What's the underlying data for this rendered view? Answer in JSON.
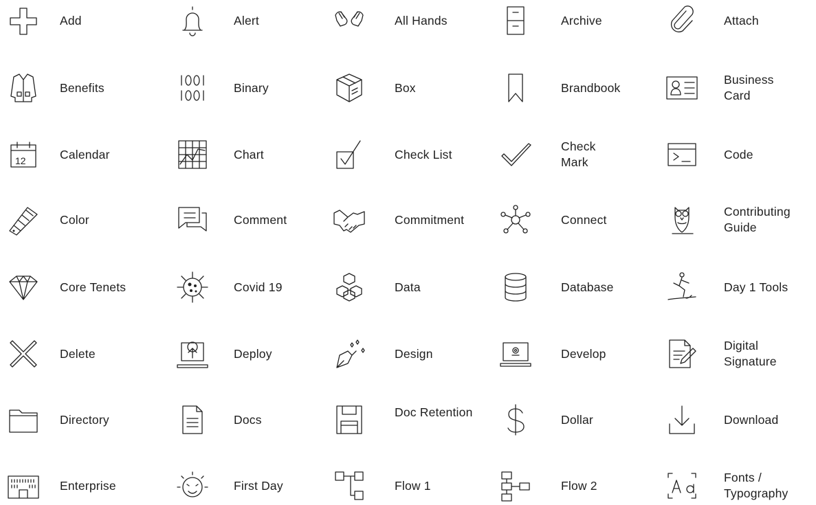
{
  "icons": [
    {
      "label": "Add",
      "icon": "plus-icon"
    },
    {
      "label": "Alert",
      "icon": "bell-icon"
    },
    {
      "label": "All Hands",
      "icon": "hands-icon"
    },
    {
      "label": "Archive",
      "icon": "file-cabinet-icon"
    },
    {
      "label": "Attach",
      "icon": "paperclip-icon"
    },
    {
      "label": "Benefits",
      "icon": "lab-coat-icon"
    },
    {
      "label": "Binary",
      "icon": "binary-icon"
    },
    {
      "label": "Box",
      "icon": "box-icon"
    },
    {
      "label": "Brandbook",
      "icon": "bookmark-icon"
    },
    {
      "label": "Business\nCard",
      "icon": "id-card-icon"
    },
    {
      "label": "Calendar",
      "icon": "calendar-icon"
    },
    {
      "label": "Chart",
      "icon": "chart-icon"
    },
    {
      "label": "Check List",
      "icon": "checkbox-icon"
    },
    {
      "label": "Check\nMark",
      "icon": "checkmark-icon"
    },
    {
      "label": "Code",
      "icon": "terminal-icon"
    },
    {
      "label": "Color",
      "icon": "color-swatch-icon"
    },
    {
      "label": "Comment",
      "icon": "comment-icon"
    },
    {
      "label": "Commitment",
      "icon": "handshake-icon"
    },
    {
      "label": "Connect",
      "icon": "network-icon"
    },
    {
      "label": "Contributing\nGuide",
      "icon": "owl-icon"
    },
    {
      "label": "Core Tenets",
      "icon": "diamond-icon"
    },
    {
      "label": "Covid 19",
      "icon": "virus-icon"
    },
    {
      "label": "Data",
      "icon": "cubes-icon"
    },
    {
      "label": "Database",
      "icon": "database-icon"
    },
    {
      "label": "Day 1 Tools",
      "icon": "surfer-icon"
    },
    {
      "label": "Delete",
      "icon": "x-icon"
    },
    {
      "label": "Deploy",
      "icon": "laptop-upload-icon"
    },
    {
      "label": "Design",
      "icon": "pen-nib-icon"
    },
    {
      "label": "Develop",
      "icon": "laptop-gear-icon"
    },
    {
      "label": "Digital\nSignature",
      "icon": "document-pen-icon"
    },
    {
      "label": "Directory",
      "icon": "folder-icon"
    },
    {
      "label": "Docs",
      "icon": "document-icon"
    },
    {
      "label": "Doc Retention",
      "icon": "floppy-disk-icon"
    },
    {
      "label": "Dollar",
      "icon": "dollar-icon"
    },
    {
      "label": "Download",
      "icon": "download-icon"
    },
    {
      "label": "Enterprise",
      "icon": "building-icon"
    },
    {
      "label": "First Day",
      "icon": "sun-face-icon"
    },
    {
      "label": "Flow 1",
      "icon": "flow-chart-icon"
    },
    {
      "label": "Flow 2",
      "icon": "flow-tree-icon"
    },
    {
      "label": "Fonts /\nTypography",
      "icon": "typography-icon"
    }
  ]
}
